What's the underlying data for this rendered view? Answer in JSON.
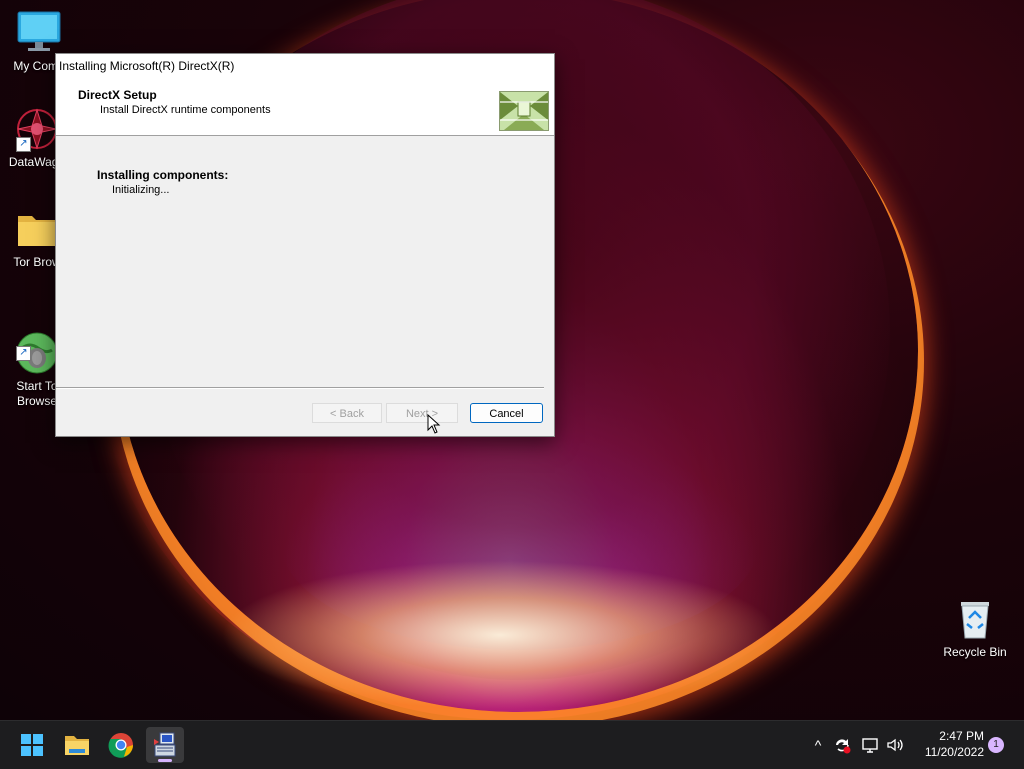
{
  "desktop": {
    "icons": [
      {
        "label": "My Comp",
        "icon": "monitor-icon"
      },
      {
        "label": "DataWago",
        "icon": "datawagon-icon"
      },
      {
        "label": "Tor Brow",
        "icon": "folder-icon"
      },
      {
        "label": "Start To\nBrowse",
        "icon": "tor-globe-icon"
      },
      {
        "label": "Recycle Bin",
        "icon": "recycle-bin-icon"
      }
    ]
  },
  "dialog": {
    "window_title": "Installing Microsoft(R) DirectX(R)",
    "header_title": "DirectX Setup",
    "header_subtitle": "Install DirectX runtime components",
    "section_label": "Installing components:",
    "status_text": "Initializing...",
    "buttons": {
      "back": "< Back",
      "next": "Next >",
      "cancel": "Cancel"
    }
  },
  "taskbar": {
    "apps": [
      "start-icon",
      "file-explorer-icon",
      "chrome-icon",
      "directx-setup-icon"
    ],
    "tray": {
      "chevron": "^",
      "time": "2:47 PM",
      "date": "11/20/2022",
      "notification_count": "1"
    }
  },
  "colors": {
    "accent": "#0067c0",
    "taskbar_bg": "#1d1d1f",
    "dialog_bg": "#f0f0f0"
  }
}
